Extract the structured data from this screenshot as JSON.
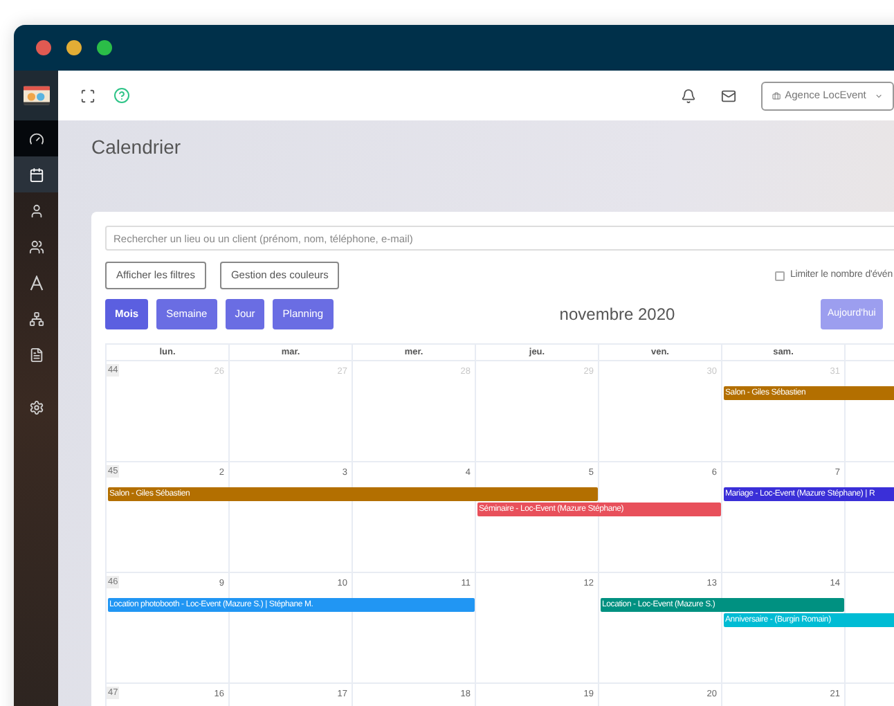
{
  "sidebar": {
    "items": [
      {
        "kind": "dashboard",
        "selected": false,
        "hovered": true
      },
      {
        "kind": "calendar",
        "selected": true,
        "hovered": false
      },
      {
        "kind": "user",
        "selected": false,
        "hovered": false
      },
      {
        "kind": "users",
        "selected": false,
        "hovered": false
      },
      {
        "kind": "letter",
        "selected": false,
        "hovered": false
      },
      {
        "kind": "network",
        "selected": false,
        "hovered": false
      },
      {
        "kind": "document",
        "selected": false,
        "hovered": false
      },
      {
        "kind": "settings",
        "selected": false,
        "hovered": false
      }
    ]
  },
  "topbar": {
    "agency": "Agence LocEvent"
  },
  "page_title": "Calendrier",
  "search": {
    "placeholder": "Rechercher un lieu ou un client (prénom, nom, téléphone, e-mail)"
  },
  "filter_buttons": [
    "Afficher les filtres",
    "Gestion des couleurs"
  ],
  "limit_checkbox": {
    "label": "Limiter le nombre d'évén",
    "checked": false
  },
  "view_buttons": [
    {
      "label": "Mois",
      "selected": true
    },
    {
      "label": "Semaine",
      "selected": false
    },
    {
      "label": "Jour",
      "selected": false
    },
    {
      "label": "Planning",
      "selected": false
    }
  ],
  "month_title": "novembre 2020",
  "today_button": {
    "label": "Aujourd'hui",
    "disabled": true
  },
  "weekdays": [
    "lun.",
    "mar.",
    "mer.",
    "jeu.",
    "ven.",
    "sam."
  ],
  "weeks": [
    {
      "number": "44",
      "days": [
        {
          "date": "26",
          "other_month": true
        },
        {
          "date": "27",
          "other_month": true
        },
        {
          "date": "28",
          "other_month": true
        },
        {
          "date": "29",
          "other_month": true
        },
        {
          "date": "30",
          "other_month": true
        },
        {
          "date": "31",
          "other_month": true
        }
      ],
      "events": [
        {
          "label": "Salon - Giles Sébastien",
          "color": "#b36f00"
        }
      ]
    },
    {
      "number": "45",
      "days": [
        {
          "date": "2",
          "other_month": false
        },
        {
          "date": "3",
          "other_month": false
        },
        {
          "date": "4",
          "other_month": false
        },
        {
          "date": "5",
          "other_month": false
        },
        {
          "date": "6",
          "other_month": false
        },
        {
          "date": "7",
          "other_month": false
        }
      ],
      "events": [
        {
          "label": "Salon - Giles Sébastien",
          "color": "#b36f00"
        },
        {
          "label": "Mariage - Loc-Event (Mazure Stéphane) | R",
          "color": "#3a2fd8"
        },
        {
          "label": "Séminaire - Loc-Event (Mazure Stéphane)",
          "color": "#e8505b"
        }
      ]
    },
    {
      "number": "46",
      "days": [
        {
          "date": "9",
          "other_month": false
        },
        {
          "date": "10",
          "other_month": false
        },
        {
          "date": "11",
          "other_month": false
        },
        {
          "date": "12",
          "other_month": false
        },
        {
          "date": "13",
          "other_month": false
        },
        {
          "date": "14",
          "other_month": false
        }
      ],
      "events": [
        {
          "label": "Location photobooth - Loc-Event (Mazure S.) | Stéphane M.",
          "color": "#2196f3"
        },
        {
          "label": "Location - Loc-Event (Mazure S.)",
          "color": "#009181"
        },
        {
          "label": "Anniversaire - (Burgin Romain)",
          "color": "#00bcd4"
        }
      ]
    },
    {
      "number": "47",
      "days": [
        {
          "date": "16",
          "other_month": false
        },
        {
          "date": "17",
          "other_month": false
        },
        {
          "date": "18",
          "other_month": false
        },
        {
          "date": "19",
          "other_month": false
        },
        {
          "date": "20",
          "other_month": false
        },
        {
          "date": "21",
          "other_month": false
        }
      ]
    }
  ]
}
